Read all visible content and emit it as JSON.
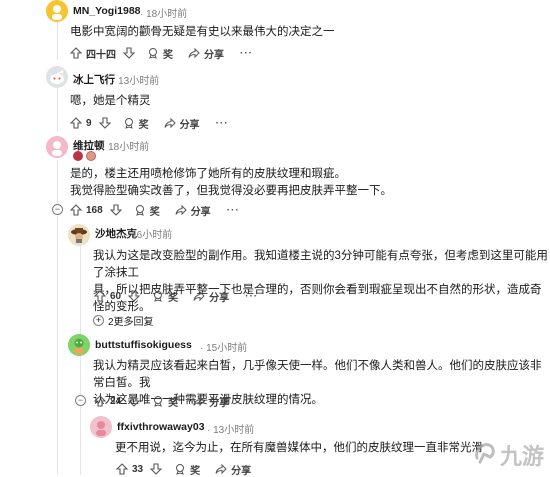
{
  "comments": [
    {
      "user": "MN_Yogi1988",
      "time": "18小时前",
      "text": [
        "电影中宽阔的颧骨无疑是有史以来最伟大的决定之一"
      ],
      "votes": "四十四",
      "reward": "奖",
      "share": "分享",
      "more": "···"
    },
    {
      "user": "冰上飞行",
      "time": "13小时前",
      "text": [
        "嗯，她是个精灵"
      ],
      "votes": "9",
      "reward": "奖",
      "share": "分享",
      "more": "···"
    },
    {
      "user": "维拉顿",
      "time": "18小时前",
      "text": [
        "是的，楼主还用喷枪修饰了她所有的皮肤纹理和瑕疵。",
        "我觉得脸型确实改善了，但我觉得没必要再把皮肤弄平整一下。"
      ],
      "votes": "168",
      "reward": "奖",
      "share": "分享",
      "more": "···"
    },
    {
      "user": "沙地杰克",
      "time": "16小时前",
      "text": [
        "我认为这是改变脸型的副作用。我知道楼主说的3分钟可能有点夸张，但考虑到这里可能用了涂抹工",
        "具，所以把皮肤弄平整一下也是合理的，否则你会看到瑕疵呈现出不自然的形状，造成奇怪的变形。"
      ],
      "votes": "60",
      "reward": "奖",
      "share": "分享",
      "more": "···",
      "more_replies": "2更多回复"
    },
    {
      "user": "buttstuffisokiguess",
      "time": "15小时前",
      "text": [
        "我认为精灵应该看起来白皙，几乎像天使一样。他们不像人类和兽人。他们的皮肤应该非常白皙。我",
        "认为这是唯一一种需要平滑皮肤纹理的情况。"
      ],
      "votes": "24",
      "reward": "奖",
      "share": "分享",
      "more": "···"
    },
    {
      "user": "ffxivthrowaway03",
      "time": "13小时前",
      "text": [
        "更不用说，迄今为止，在所有魔兽媒体中，他们的皮肤纹理一直非常光滑"
      ],
      "votes": "33",
      "reward": "奖",
      "share": "分享"
    }
  ],
  "watermark": "九游",
  "colors": {
    "upvote": "#555555",
    "thread_line": "#e3e5e8",
    "muted": "#7c7c7c"
  }
}
